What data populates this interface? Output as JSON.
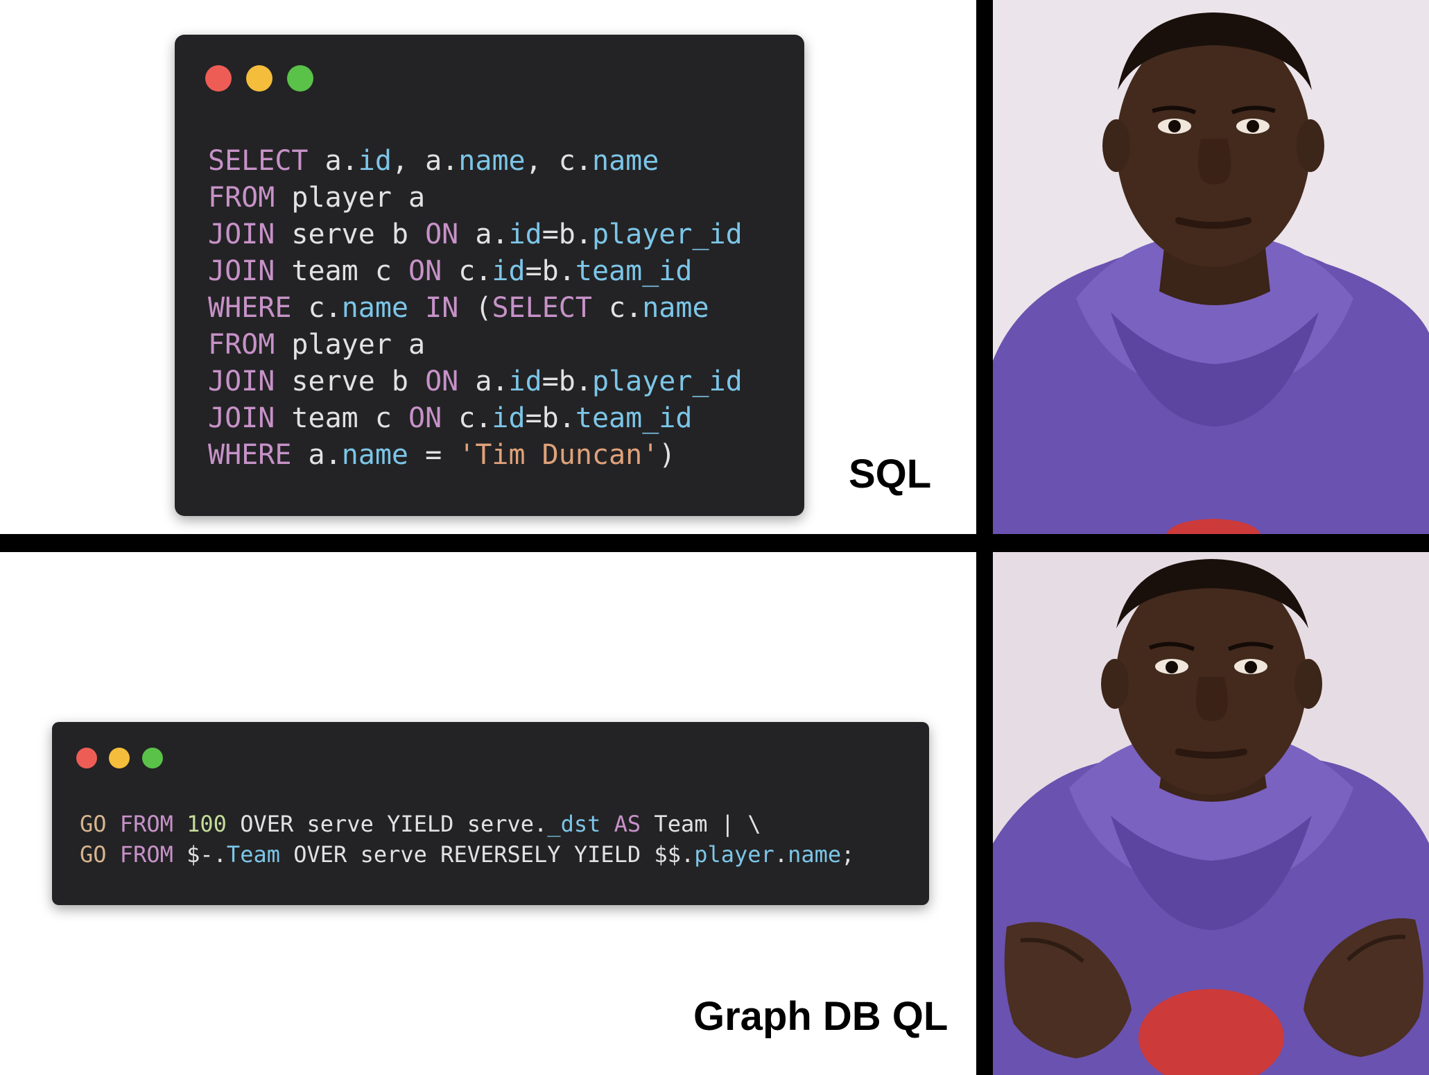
{
  "top_panel": {
    "code_lines": [
      [
        [
          "kw",
          "SELECT"
        ],
        [
          "plain",
          " a"
        ],
        [
          "punct",
          "."
        ],
        [
          "prop",
          "id"
        ],
        [
          "punct",
          ","
        ],
        [
          "plain",
          " a"
        ],
        [
          "punct",
          "."
        ],
        [
          "prop",
          "name"
        ],
        [
          "punct",
          ","
        ],
        [
          "plain",
          " c"
        ],
        [
          "punct",
          "."
        ],
        [
          "prop",
          "name"
        ]
      ],
      [
        [
          "kw",
          "FROM"
        ],
        [
          "plain",
          " player a"
        ]
      ],
      [
        [
          "kw",
          "JOIN"
        ],
        [
          "plain",
          " serve b "
        ],
        [
          "kw",
          "ON"
        ],
        [
          "plain",
          " a"
        ],
        [
          "punct",
          "."
        ],
        [
          "prop",
          "id"
        ],
        [
          "plain",
          "=b"
        ],
        [
          "punct",
          "."
        ],
        [
          "prop",
          "player_id"
        ]
      ],
      [
        [
          "kw",
          "JOIN"
        ],
        [
          "plain",
          " team c "
        ],
        [
          "kw",
          "ON"
        ],
        [
          "plain",
          " c"
        ],
        [
          "punct",
          "."
        ],
        [
          "prop",
          "id"
        ],
        [
          "plain",
          "=b"
        ],
        [
          "punct",
          "."
        ],
        [
          "prop",
          "team_id"
        ]
      ],
      [
        [
          "kw",
          "WHERE"
        ],
        [
          "plain",
          " c"
        ],
        [
          "punct",
          "."
        ],
        [
          "prop",
          "name"
        ],
        [
          "plain",
          " "
        ],
        [
          "kw",
          "IN"
        ],
        [
          "plain",
          " ("
        ],
        [
          "kw",
          "SELECT"
        ],
        [
          "plain",
          " c"
        ],
        [
          "punct",
          "."
        ],
        [
          "prop",
          "name"
        ]
      ],
      [
        [
          "kw",
          "FROM"
        ],
        [
          "plain",
          " player a"
        ]
      ],
      [
        [
          "kw",
          "JOIN"
        ],
        [
          "plain",
          " serve b "
        ],
        [
          "kw",
          "ON"
        ],
        [
          "plain",
          " a"
        ],
        [
          "punct",
          "."
        ],
        [
          "prop",
          "id"
        ],
        [
          "plain",
          "=b"
        ],
        [
          "punct",
          "."
        ],
        [
          "prop",
          "player_id"
        ]
      ],
      [
        [
          "kw",
          "JOIN"
        ],
        [
          "plain",
          " team c "
        ],
        [
          "kw",
          "ON"
        ],
        [
          "plain",
          " c"
        ],
        [
          "punct",
          "."
        ],
        [
          "prop",
          "id"
        ],
        [
          "plain",
          "=b"
        ],
        [
          "punct",
          "."
        ],
        [
          "prop",
          "team_id"
        ]
      ],
      [
        [
          "kw",
          "WHERE"
        ],
        [
          "plain",
          " a"
        ],
        [
          "punct",
          "."
        ],
        [
          "prop",
          "name"
        ],
        [
          "plain",
          " = "
        ],
        [
          "str",
          "'Tim Duncan'"
        ],
        [
          "plain",
          ")"
        ]
      ]
    ],
    "label": "SQL"
  },
  "bottom_panel": {
    "code_lines": [
      [
        [
          "go",
          "GO"
        ],
        [
          "plain",
          " "
        ],
        [
          "kw",
          "FROM"
        ],
        [
          "plain",
          " "
        ],
        [
          "num",
          "100"
        ],
        [
          "plain",
          " OVER serve YIELD serve"
        ],
        [
          "punct",
          "."
        ],
        [
          "prop",
          "_dst"
        ],
        [
          "plain",
          " "
        ],
        [
          "kw",
          "AS"
        ],
        [
          "plain",
          " Team | \\"
        ]
      ],
      [
        [
          "go",
          "GO"
        ],
        [
          "plain",
          " "
        ],
        [
          "kw",
          "FROM"
        ],
        [
          "plain",
          " $-"
        ],
        [
          "punct",
          "."
        ],
        [
          "prop",
          "Team"
        ],
        [
          "plain",
          " OVER serve REVERSELY YIELD $$"
        ],
        [
          "punct",
          "."
        ],
        [
          "prop",
          "player"
        ],
        [
          "punct",
          "."
        ],
        [
          "prop",
          "name"
        ],
        [
          "plain",
          ";"
        ]
      ]
    ],
    "label": "Graph DB QL"
  },
  "window_dots": [
    "#ee5d55",
    "#f4bd3b",
    "#5ac248"
  ],
  "colors": {
    "code_background": "#232325",
    "keyword": "#c792c8",
    "property": "#7cc6e8",
    "string": "#e0a27a",
    "number": "#c5dd9a",
    "hoodie": "#6e56b4",
    "divider": "#000000"
  }
}
